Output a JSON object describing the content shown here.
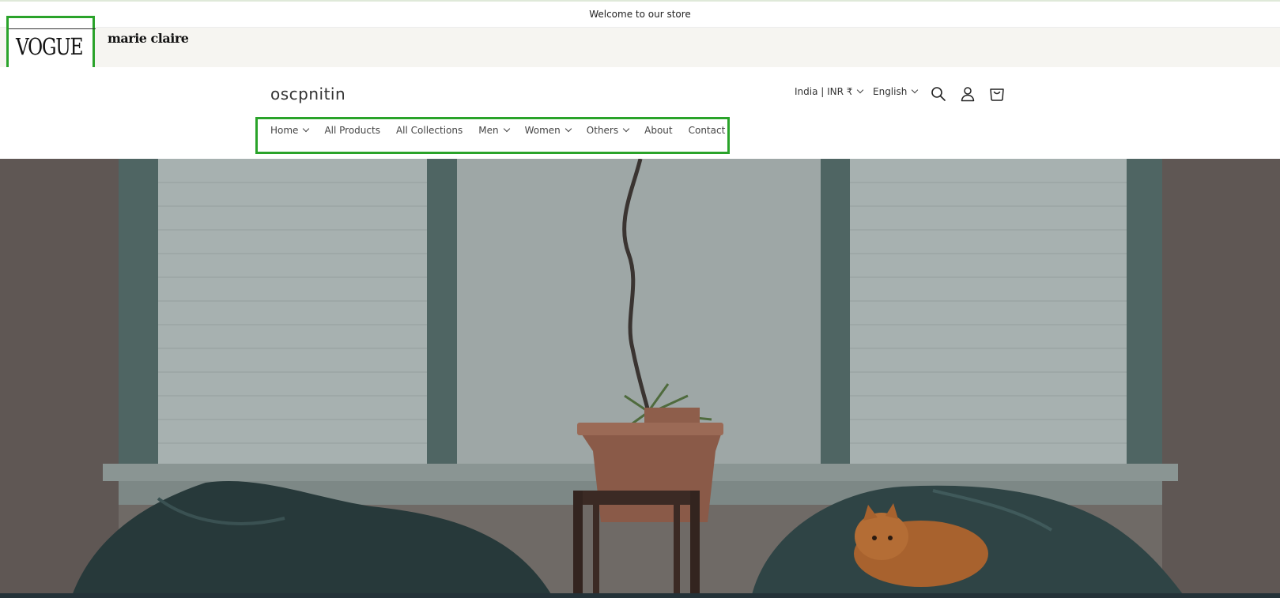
{
  "announcement": {
    "text": "Welcome to our store"
  },
  "brand_logos": {
    "vogue": "VOGUE",
    "marie_claire": "marie claire"
  },
  "header": {
    "shop_name": "oscpnitin",
    "country_selector": "India | INR ₹",
    "language_selector": "English",
    "icons": [
      "search-icon",
      "account-icon",
      "cart-icon"
    ]
  },
  "nav": {
    "items": [
      {
        "label": "Home",
        "has_dropdown": true
      },
      {
        "label": "All Products",
        "has_dropdown": false
      },
      {
        "label": "All Collections",
        "has_dropdown": false
      },
      {
        "label": "Men",
        "has_dropdown": true
      },
      {
        "label": "Women",
        "has_dropdown": true
      },
      {
        "label": "Others",
        "has_dropdown": true
      },
      {
        "label": "About",
        "has_dropdown": false
      },
      {
        "label": "Contact",
        "has_dropdown": false
      }
    ]
  },
  "colors": {
    "highlight_box": "#2aa32a",
    "logo_band": "#f6f5f1"
  }
}
